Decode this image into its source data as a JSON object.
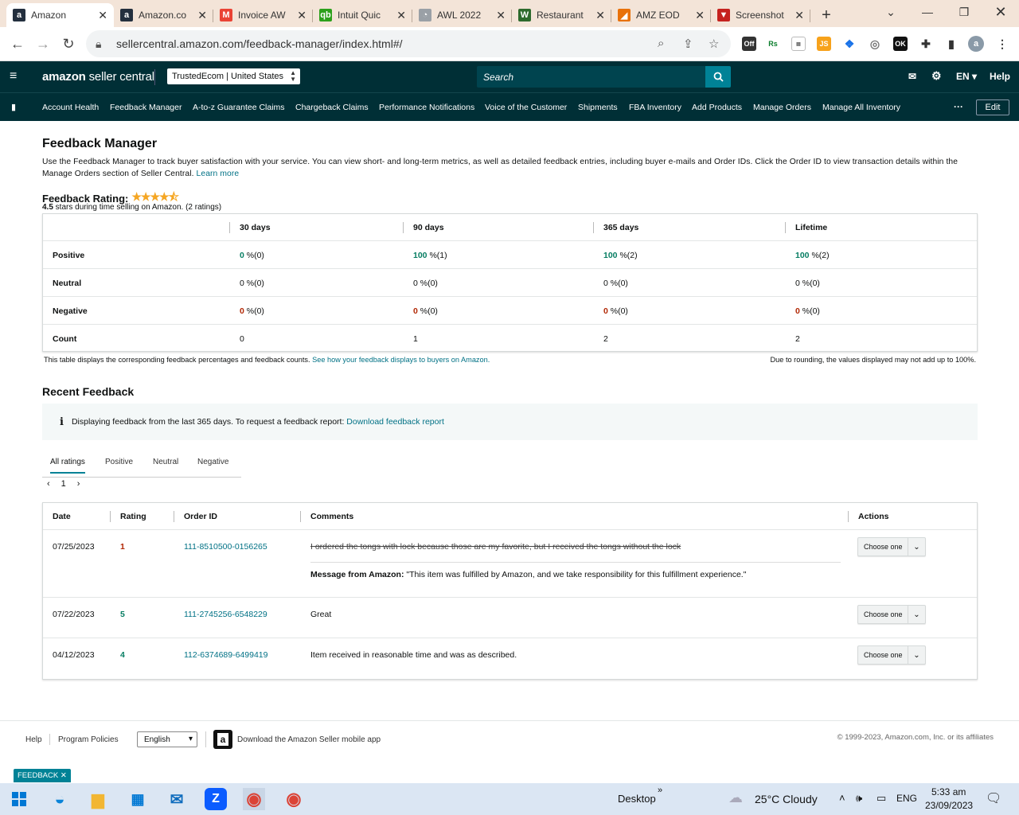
{
  "browser": {
    "tabs": [
      {
        "title": "Amazon",
        "fav": "a",
        "color": "#232f3e"
      },
      {
        "title": "Amazon.co",
        "fav": "a",
        "color": "#232f3e"
      },
      {
        "title": "Invoice AW",
        "fav": "M",
        "color": "#ea4335"
      },
      {
        "title": "Intuit Quic",
        "fav": "qb",
        "color": "#2ca01c"
      },
      {
        "title": "AWL 2022",
        "fav": "◔",
        "color": "#9aa0a6"
      },
      {
        "title": "Restaurant",
        "fav": "W",
        "color": "#2d6a2d"
      },
      {
        "title": "AMZ EOD",
        "fav": "◢",
        "color": "#e8710a"
      },
      {
        "title": "Screenshot",
        "fav": "▼",
        "color": "#c5221f"
      }
    ],
    "url": "sellercentral.amazon.com/feedback-manager/index.html#/"
  },
  "header": {
    "logo_bold": "amazon",
    "logo_light": " seller central",
    "store": "TrustedEcom | United States",
    "search_placeholder": "Search",
    "lang": "EN",
    "help": "Help"
  },
  "nav": {
    "items": [
      "Account Health",
      "Feedback Manager",
      "A-to-z Guarantee Claims",
      "Chargeback Claims",
      "Performance Notifications",
      "Voice of the Customer",
      "Shipments",
      "FBA Inventory",
      "Add Products",
      "Manage Orders",
      "Manage All Inventory"
    ],
    "more": "···",
    "edit": "Edit"
  },
  "page": {
    "title": "Feedback Manager",
    "intro": "Use the Feedback Manager to track buyer satisfaction with your service. You can view short- and long-term metrics, as well as detailed feedback entries, including buyer e-mails and Order IDs. Click the Order ID to view transaction details within the Manage Orders section of Seller Central.",
    "learn_more": "Learn more",
    "rating_label": "Feedback Rating:",
    "stars": "★★★★⯪",
    "rating_bold": "4.5",
    "rating_rest": " stars during time selling on Amazon. (2 ratings)"
  },
  "metrics": {
    "columns": [
      "30 days",
      "90 days",
      "365 days",
      "Lifetime"
    ],
    "rows": [
      {
        "label": "Positive",
        "cells": [
          [
            "0",
            " %(0)"
          ],
          [
            "100",
            " %(1)"
          ],
          [
            "100",
            " %(2)"
          ],
          [
            "100",
            " %(2)"
          ]
        ],
        "kind": "green"
      },
      {
        "label": "Neutral",
        "cells": [
          [
            "0 %(0)",
            ""
          ],
          [
            "0 %(0)",
            ""
          ],
          [
            "0 %(0)",
            ""
          ],
          [
            "0 %(0)",
            ""
          ]
        ],
        "kind": "plain"
      },
      {
        "label": "Negative",
        "cells": [
          [
            "0",
            " %(0)"
          ],
          [
            "0",
            " %(0)"
          ],
          [
            "0",
            " %(0)"
          ],
          [
            "0",
            " %(0)"
          ]
        ],
        "kind": "red"
      },
      {
        "label": "Count",
        "cells": [
          [
            "0",
            ""
          ],
          [
            "1",
            ""
          ],
          [
            "2",
            ""
          ],
          [
            "2",
            ""
          ]
        ],
        "kind": "plain"
      }
    ],
    "note_left": "This table displays the corresponding feedback percentages and feedback counts.",
    "note_link": "See how your feedback displays to buyers on Amazon.",
    "note_right": "Due to rounding, the values displayed may not add up to 100%."
  },
  "recent": {
    "title": "Recent Feedback",
    "info_text": "Displaying feedback from the last 365 days. To request a feedback report:",
    "info_link": "Download feedback report",
    "filters": [
      "All ratings",
      "Positive",
      "Neutral",
      "Negative"
    ],
    "page_num": "1",
    "columns": [
      "Date",
      "Rating",
      "Order ID",
      "Comments",
      "Actions"
    ],
    "rows": [
      {
        "date": "07/25/2023",
        "rating": "1",
        "order": "111-8510500-0156265",
        "comment": "I ordered the tongs with lock because those are my favorite, but I received the tongs without the lock",
        "msg_label": "Message from Amazon:",
        "msg": " \"This item was fulfilled by Amazon, and we take responsibility for this fulfillment experience.\""
      },
      {
        "date": "07/22/2023",
        "rating": "5",
        "order": "111-2745256-6548229",
        "comment": "Great"
      },
      {
        "date": "04/12/2023",
        "rating": "4",
        "order": "112-6374689-6499419",
        "comment": "Item received in reasonable time and was as described."
      }
    ],
    "action_label": "Choose one"
  },
  "footer": {
    "help": "Help",
    "policies": "Program Policies",
    "language": "English",
    "app": "Download the Amazon Seller mobile app",
    "copyright": "© 1999-2023, Amazon.com, Inc. or its affiliates",
    "feedback_tag": "FEEDBACK ✕"
  },
  "taskbar": {
    "desktop": "Desktop",
    "weather": "25°C  Cloudy",
    "lang": "ENG",
    "time": "5:33 am",
    "date": "23/09/2023"
  }
}
